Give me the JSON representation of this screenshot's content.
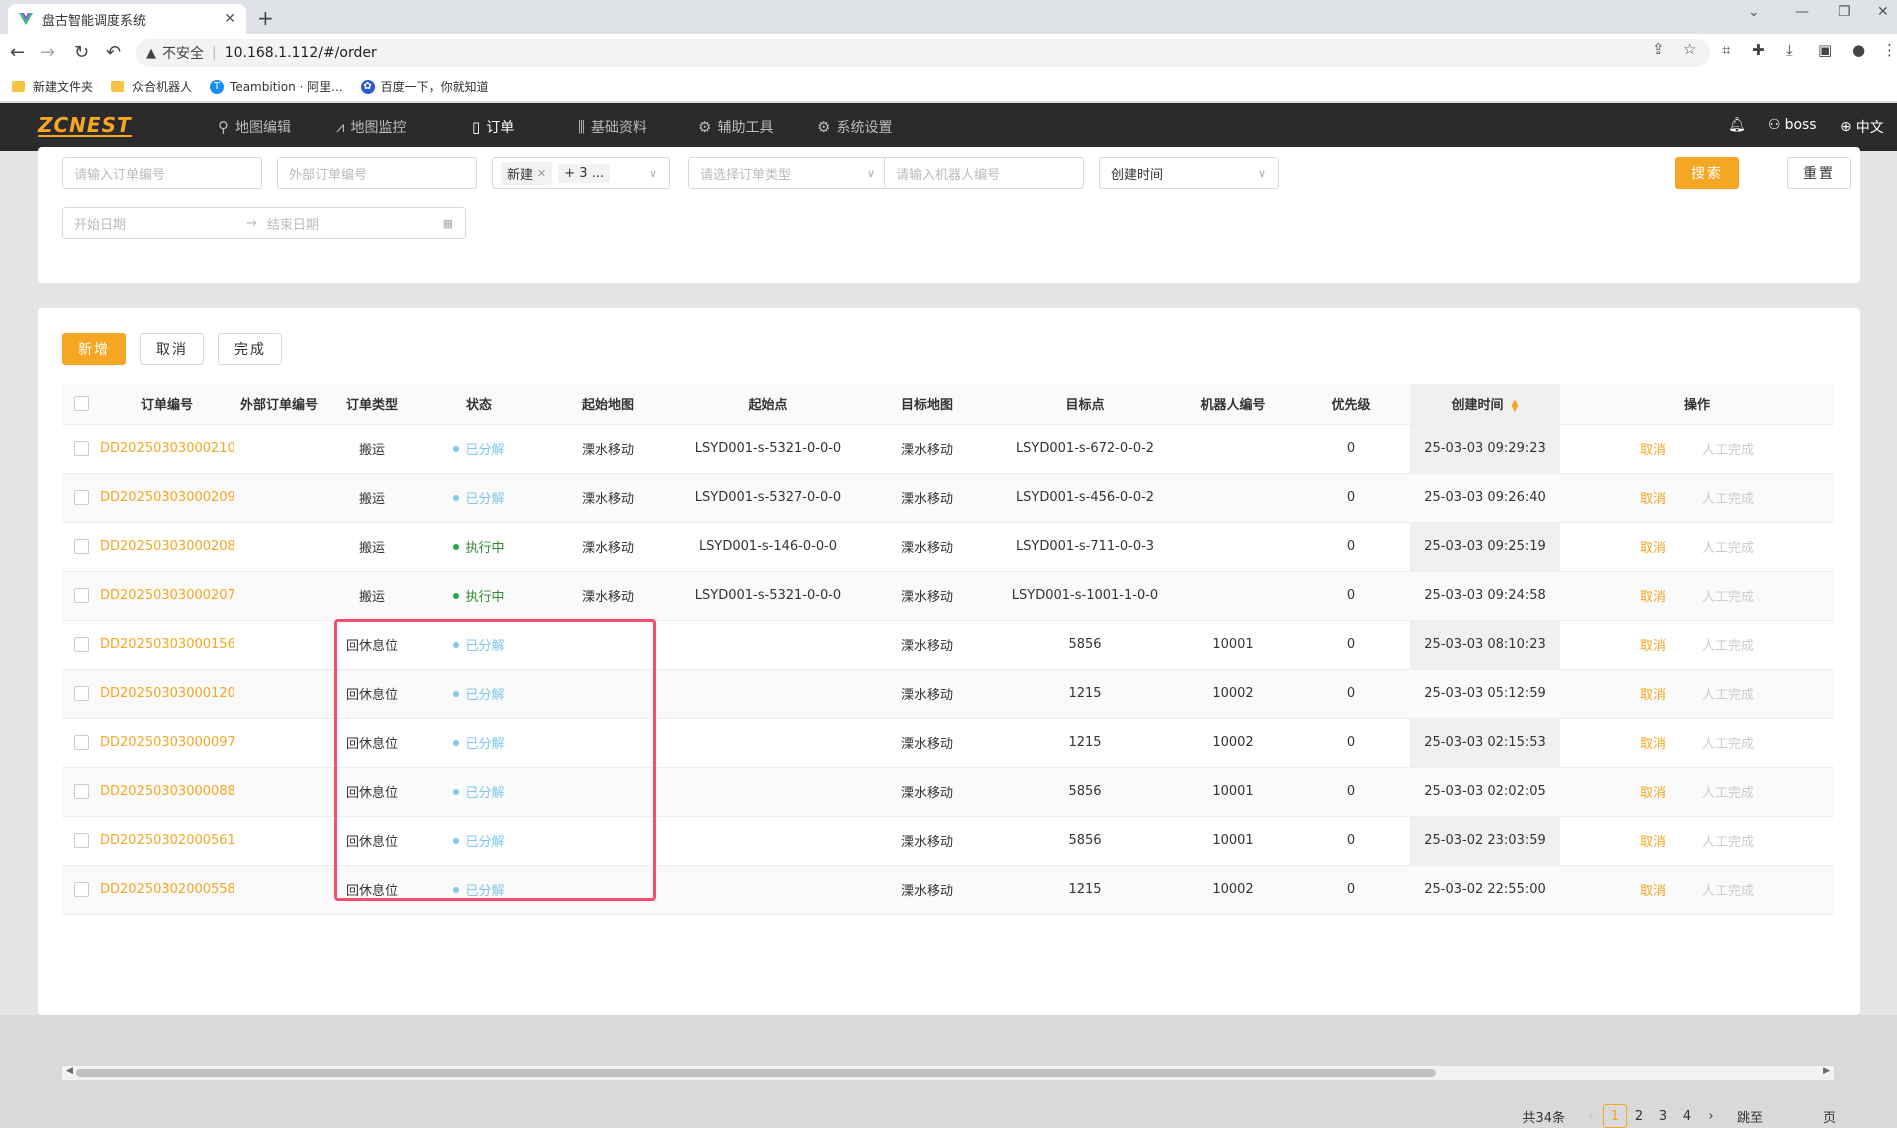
{
  "browser": {
    "tab_title": "盘古智能调度系统",
    "insecure_label": "不安全",
    "url": "10.168.1.112/#/order",
    "bookmarks": [
      {
        "label": "新建文件夹"
      },
      {
        "label": "众合机器人"
      },
      {
        "label": "Teambition · 阿里..."
      },
      {
        "label": "百度一下，你就知道"
      }
    ]
  },
  "app": {
    "logo": "ZCNEST",
    "nav": [
      {
        "label": "地图编辑",
        "icon": "location-pin-icon"
      },
      {
        "label": "地图监控",
        "icon": "chart-line-icon"
      },
      {
        "label": "订单",
        "icon": "document-icon",
        "active": true
      },
      {
        "label": "基础资料",
        "icon": "sliders-icon"
      },
      {
        "label": "辅助工具",
        "icon": "gear-icon"
      },
      {
        "label": "系统设置",
        "icon": "gear-icon"
      }
    ],
    "user": "boss",
    "language": "中文",
    "accent_color": "#f5a623"
  },
  "filters": {
    "order_no_placeholder": "请输入订单编号",
    "external_no_placeholder": "外部订单编号",
    "status_tag": "新建",
    "status_more": "+ 3 ...",
    "type_placeholder": "请选择订单类型",
    "robot_placeholder": "请输入机器人编号",
    "time_field": "创建时间",
    "start_date": "开始日期",
    "end_date": "结束日期",
    "search_label": "搜索",
    "reset_label": "重置"
  },
  "toolbar": {
    "add_label": "新增",
    "cancel_label": "取消",
    "complete_label": "完成"
  },
  "table": {
    "columns": [
      "订单编号",
      "外部订单编号",
      "订单类型",
      "状态",
      "起始地图",
      "起始点",
      "目标地图",
      "目标点",
      "机器人编号",
      "优先级",
      "创建时间",
      "操作"
    ],
    "rows": [
      {
        "order": "DD20250303000210",
        "ext": "",
        "type": "搬运",
        "status": "已分解",
        "status_color": "#7ec8f0",
        "from_map": "溧水移动",
        "from_pt": "LSYD001-s-5321-0-0-0",
        "to_map": "溧水移动",
        "to_pt": "LSYD001-s-672-0-0-2",
        "robot": "",
        "priority": "0",
        "created": "25-03-03 09:29:23",
        "op_cancel": "取消",
        "op_done": "人工完成"
      },
      {
        "order": "DD20250303000209",
        "ext": "",
        "type": "搬运",
        "status": "已分解",
        "status_color": "#7ec8f0",
        "from_map": "溧水移动",
        "from_pt": "LSYD001-s-5327-0-0-0",
        "to_map": "溧水移动",
        "to_pt": "LSYD001-s-456-0-0-2",
        "robot": "",
        "priority": "0",
        "created": "25-03-03 09:26:40",
        "op_cancel": "取消",
        "op_done": "人工完成"
      },
      {
        "order": "DD20250303000208",
        "ext": "",
        "type": "搬运",
        "status": "执行中",
        "status_color": "#28a745",
        "from_map": "溧水移动",
        "from_pt": "LSYD001-s-146-0-0-0",
        "to_map": "溧水移动",
        "to_pt": "LSYD001-s-711-0-0-3",
        "robot": "",
        "priority": "0",
        "created": "25-03-03 09:25:19",
        "op_cancel": "取消",
        "op_done": "人工完成"
      },
      {
        "order": "DD20250303000207",
        "ext": "",
        "type": "搬运",
        "status": "执行中",
        "status_color": "#28a745",
        "from_map": "溧水移动",
        "from_pt": "LSYD001-s-5321-0-0-0",
        "to_map": "溧水移动",
        "to_pt": "LSYD001-s-1001-1-0-0",
        "robot": "",
        "priority": "0",
        "created": "25-03-03 09:24:58",
        "op_cancel": "取消",
        "op_done": "人工完成"
      },
      {
        "order": "DD20250303000156",
        "ext": "",
        "type": "回休息位",
        "status": "已分解",
        "status_color": "#7ec8f0",
        "from_map": "",
        "from_pt": "",
        "to_map": "溧水移动",
        "to_pt": "5856",
        "robot": "10001",
        "priority": "0",
        "created": "25-03-03 08:10:23",
        "op_cancel": "取消",
        "op_done": "人工完成"
      },
      {
        "order": "DD20250303000120",
        "ext": "",
        "type": "回休息位",
        "status": "已分解",
        "status_color": "#7ec8f0",
        "from_map": "",
        "from_pt": "",
        "to_map": "溧水移动",
        "to_pt": "1215",
        "robot": "10002",
        "priority": "0",
        "created": "25-03-03 05:12:59",
        "op_cancel": "取消",
        "op_done": "人工完成"
      },
      {
        "order": "DD20250303000097",
        "ext": "",
        "type": "回休息位",
        "status": "已分解",
        "status_color": "#7ec8f0",
        "from_map": "",
        "from_pt": "",
        "to_map": "溧水移动",
        "to_pt": "1215",
        "robot": "10002",
        "priority": "0",
        "created": "25-03-03 02:15:53",
        "op_cancel": "取消",
        "op_done": "人工完成"
      },
      {
        "order": "DD20250303000088",
        "ext": "",
        "type": "回休息位",
        "status": "已分解",
        "status_color": "#7ec8f0",
        "from_map": "",
        "from_pt": "",
        "to_map": "溧水移动",
        "to_pt": "5856",
        "robot": "10001",
        "priority": "0",
        "created": "25-03-03 02:02:05",
        "op_cancel": "取消",
        "op_done": "人工完成"
      },
      {
        "order": "DD20250302000561",
        "ext": "",
        "type": "回休息位",
        "status": "已分解",
        "status_color": "#7ec8f0",
        "from_map": "",
        "from_pt": "",
        "to_map": "溧水移动",
        "to_pt": "5856",
        "robot": "10001",
        "priority": "0",
        "created": "25-03-02 23:03:59",
        "op_cancel": "取消",
        "op_done": "人工完成"
      },
      {
        "order": "DD20250302000558",
        "ext": "",
        "type": "回休息位",
        "status": "已分解",
        "status_color": "#7ec8f0",
        "from_map": "",
        "from_pt": "",
        "to_map": "溧水移动",
        "to_pt": "1215",
        "robot": "10002",
        "priority": "0",
        "created": "25-03-02 22:55:00",
        "op_cancel": "取消",
        "op_done": "人工完成"
      }
    ]
  },
  "pagination": {
    "total": "共34条",
    "pages": [
      "1",
      "2",
      "3",
      "4"
    ],
    "current": "1",
    "jump_label": "跳至",
    "page_suffix": "页"
  }
}
